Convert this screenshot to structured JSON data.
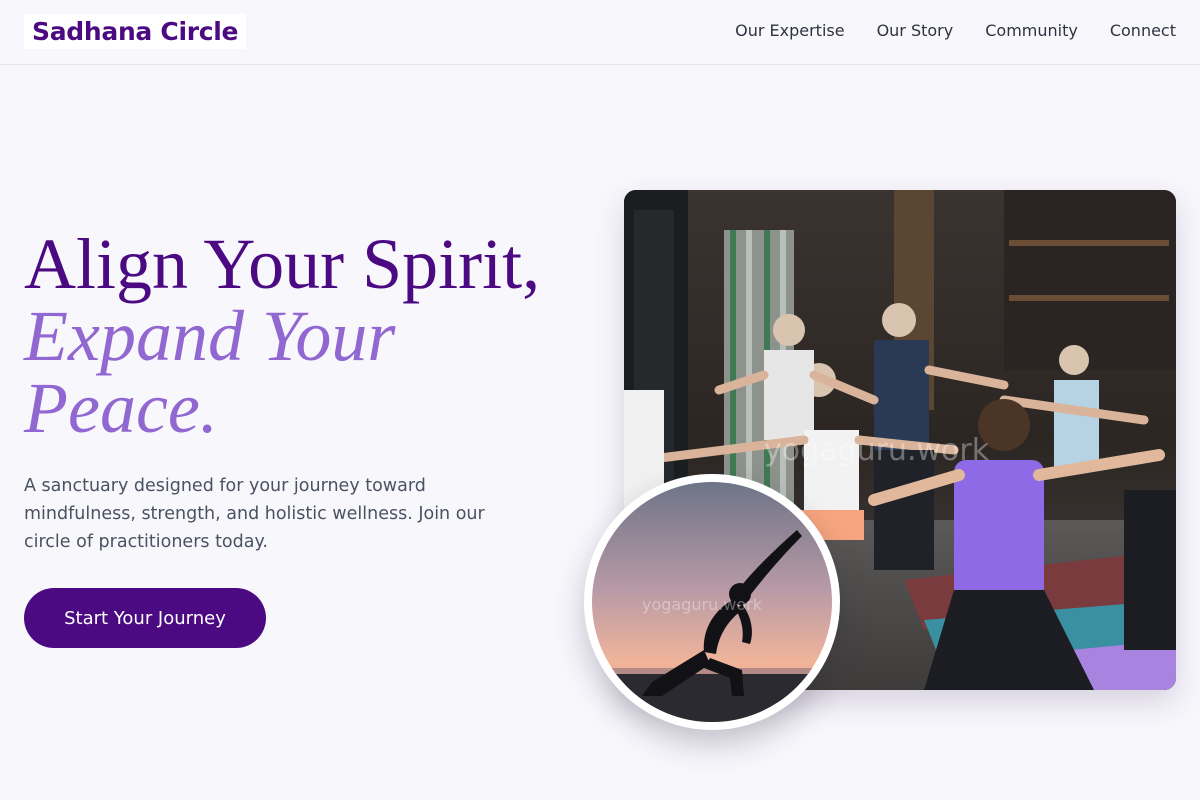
{
  "header": {
    "logo": "Sadhana Circle",
    "nav": [
      {
        "label": "Our Expertise"
      },
      {
        "label": "Our Story"
      },
      {
        "label": "Community"
      },
      {
        "label": "Connect"
      }
    ]
  },
  "hero": {
    "title_line1": "Align Your Spirit,",
    "title_line2": "Expand Your Peace.",
    "description": "A sanctuary designed for your journey toward mindfulness, strength, and holistic wellness. Join our circle of practitioners today.",
    "cta_label": "Start Your Journey"
  },
  "images": {
    "main_watermark": "yogaguru.work",
    "circle_watermark": "yogaguru.work"
  },
  "colors": {
    "brand": "#4b0a82",
    "accent": "#9167d1",
    "background": "#f8f7fc"
  }
}
